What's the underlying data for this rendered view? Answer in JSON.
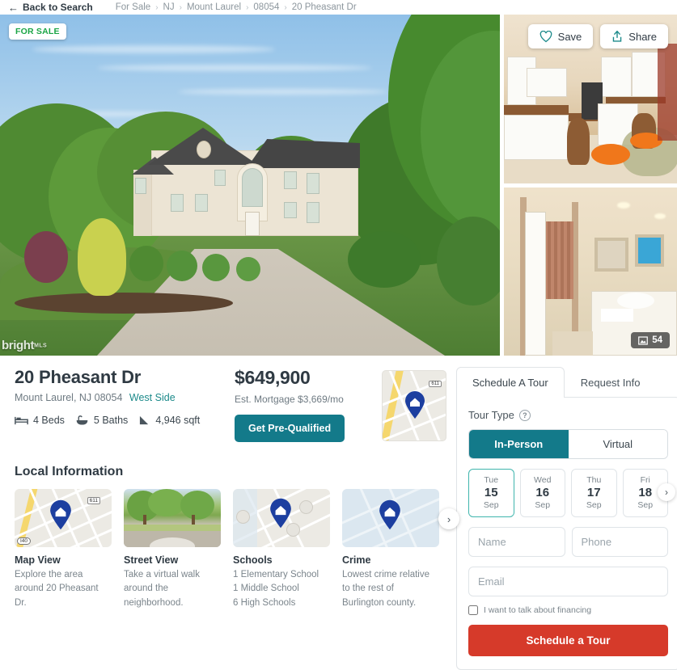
{
  "topbar": {
    "back_label": "Back to Search",
    "back_icon": "arrow-left-icon",
    "breadcrumbs": [
      "For Sale",
      "NJ",
      "Mount Laurel",
      "08054",
      "20 Pheasant Dr"
    ],
    "separator": "›"
  },
  "gallery": {
    "status_badge": "FOR SALE",
    "watermark": "bright",
    "watermark_sub": "MLS",
    "save_label": "Save",
    "save_icon": "heart-icon",
    "share_label": "Share",
    "share_icon": "share-upload-icon",
    "photo_count": "54",
    "photo_icon": "image-icon"
  },
  "property": {
    "address": "20 Pheasant Dr",
    "city_state_zip": "Mount Laurel, NJ 08054",
    "neighborhood": "West Side",
    "beds": "4 Beds",
    "baths": "5 Baths",
    "sqft": "4,946 sqft",
    "beds_icon": "bed-icon",
    "baths_icon": "bathtub-icon",
    "sqft_icon": "area-icon",
    "price": "$649,900",
    "est_mortgage": "Est. Mortgage $3,669/mo",
    "prequal_label": "Get Pre-Qualified",
    "map_route_shield": "611",
    "map_pin_icon": "home-map-pin-icon"
  },
  "local": {
    "heading": "Local Information",
    "next_icon": "chevron-right-icon",
    "cards": [
      {
        "title": "Map View",
        "desc": [
          "Explore the area",
          "around 20 Pheasant",
          "Dr."
        ],
        "img": "map-thumbnail",
        "shield_top": "611",
        "shield_bottom": "I40"
      },
      {
        "title": "Street View",
        "desc": [
          "Take a virtual walk",
          "around the",
          "neighborhood."
        ],
        "img": "street-view-thumbnail"
      },
      {
        "title": "Schools",
        "desc": [
          "1 Elementary School",
          "1 Middle School",
          "6 High Schools"
        ],
        "img": "schools-map-thumbnail"
      },
      {
        "title": "Crime",
        "desc": [
          "Lowest crime relative",
          "to the rest of",
          "Burlington county."
        ],
        "img": "crime-map-thumbnail"
      }
    ]
  },
  "tour": {
    "tabs": [
      {
        "label": "Schedule A Tour",
        "active": true
      },
      {
        "label": "Request Info",
        "active": false
      }
    ],
    "tour_type_label": "Tour Type",
    "help_icon": "question-mark-icon",
    "segments": [
      {
        "label": "In-Person",
        "selected": true
      },
      {
        "label": "Virtual",
        "selected": false
      }
    ],
    "dates": [
      {
        "weekday": "Tue",
        "day": "15",
        "month": "Sep",
        "selected": true
      },
      {
        "weekday": "Wed",
        "day": "16",
        "month": "Sep",
        "selected": false
      },
      {
        "weekday": "Thu",
        "day": "17",
        "month": "Sep",
        "selected": false
      },
      {
        "weekday": "Fri",
        "day": "18",
        "month": "Sep",
        "selected": false
      }
    ],
    "date_next_icon": "chevron-right-icon",
    "fields": {
      "name_placeholder": "Name",
      "name_value": "",
      "phone_placeholder": "Phone",
      "phone_value": "",
      "email_placeholder": "Email",
      "email_value": ""
    },
    "financing_label": "I want to talk about financing",
    "submit_label": "Schedule a Tour"
  },
  "colors": {
    "teal": "#137a8a",
    "red": "#d63a2a",
    "green_badge": "#1aa545",
    "link_teal": "#1c8a8a",
    "selected_border": "#3fb5ad",
    "pin_blue": "#1d3fa0"
  }
}
